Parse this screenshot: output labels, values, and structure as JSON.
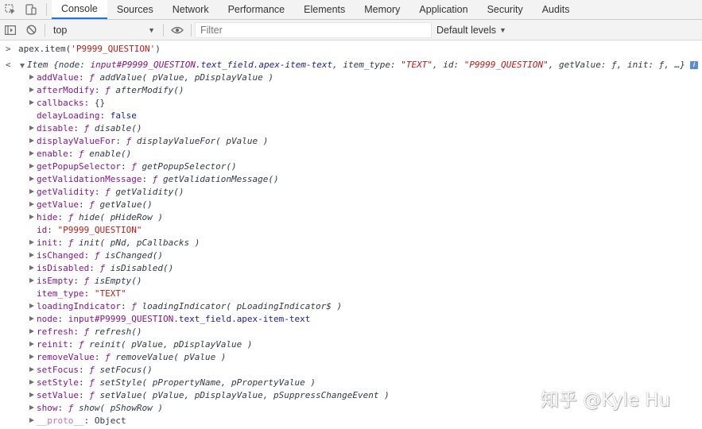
{
  "devtools": {
    "tabs": [
      {
        "label": "Console",
        "active": true
      },
      {
        "label": "Sources",
        "active": false
      },
      {
        "label": "Network",
        "active": false
      },
      {
        "label": "Performance",
        "active": false
      },
      {
        "label": "Elements",
        "active": false
      },
      {
        "label": "Memory",
        "active": false
      },
      {
        "label": "Application",
        "active": false
      },
      {
        "label": "Security",
        "active": false
      },
      {
        "label": "Audits",
        "active": false
      }
    ],
    "icons": [
      "inspect-element-icon",
      "device-toolbar-icon"
    ],
    "accent_color": "#1a73e8"
  },
  "console_toolbar": {
    "context": "top",
    "filter_placeholder": "Filter",
    "levels_label": "Default levels",
    "icons": [
      "sidebar-toggle-icon",
      "clear-console-icon",
      "live-expression-eye-icon"
    ]
  },
  "console": {
    "command": "apex.item('P9999_QUESTION')",
    "result_summary": {
      "prefix": "Item {node: ",
      "node_elem": "input",
      "node_id": "#P9999_QUESTION",
      "node_cls": ".text_field.apex-item-text",
      "mid1": ", item_type: ",
      "item_type": "\"TEXT\"",
      "mid2": ", id: ",
      "id": "\"P9999_QUESTION\"",
      "tail": ", getValue: ƒ, init: ƒ, …}",
      "info_badge": "i"
    },
    "properties": [
      {
        "key": "addValue",
        "sep": ": ",
        "f": "ƒ",
        "sig": "addValue( pValue, pDisplayValue )",
        "type": "fn",
        "expandable": true
      },
      {
        "key": "afterModify",
        "sep": ": ",
        "f": "ƒ",
        "sig": "afterModify()",
        "type": "fn",
        "expandable": true
      },
      {
        "key": "callbacks",
        "sep": ": ",
        "value": "{}",
        "type": "plain",
        "expandable": true
      },
      {
        "key": "delayLoading",
        "sep": ": ",
        "value": "false",
        "type": "kw",
        "expandable": false
      },
      {
        "key": "disable",
        "sep": ": ",
        "f": "ƒ",
        "sig": "disable()",
        "type": "fn",
        "expandable": true
      },
      {
        "key": "displayValueFor",
        "sep": ": ",
        "f": "ƒ",
        "sig": "displayValueFor( pValue )",
        "type": "fn",
        "expandable": true
      },
      {
        "key": "enable",
        "sep": ": ",
        "f": "ƒ",
        "sig": "enable()",
        "type": "fn",
        "expandable": true
      },
      {
        "key": "getPopupSelector",
        "sep": ": ",
        "f": "ƒ",
        "sig": "getPopupSelector()",
        "type": "fn",
        "expandable": true
      },
      {
        "key": "getValidationMessage",
        "sep": ": ",
        "f": "ƒ",
        "sig": "getValidationMessage()",
        "type": "fn",
        "expandable": true
      },
      {
        "key": "getValidity",
        "sep": ": ",
        "f": "ƒ",
        "sig": "getValidity()",
        "type": "fn",
        "expandable": true
      },
      {
        "key": "getValue",
        "sep": ": ",
        "f": "ƒ",
        "sig": "getValue()",
        "type": "fn",
        "expandable": true
      },
      {
        "key": "hide",
        "sep": ": ",
        "f": "ƒ",
        "sig": "hide( pHideRow )",
        "type": "fn",
        "expandable": true
      },
      {
        "key": "id",
        "sep": ": ",
        "value": "\"P9999_QUESTION\"",
        "type": "str",
        "expandable": false
      },
      {
        "key": "init",
        "sep": ": ",
        "f": "ƒ",
        "sig": "init( pNd, pCallbacks )",
        "type": "fn",
        "expandable": true
      },
      {
        "key": "isChanged",
        "sep": ": ",
        "f": "ƒ",
        "sig": "isChanged()",
        "type": "fn",
        "expandable": true
      },
      {
        "key": "isDisabled",
        "sep": ": ",
        "f": "ƒ",
        "sig": "isDisabled()",
        "type": "fn",
        "expandable": true
      },
      {
        "key": "isEmpty",
        "sep": ": ",
        "f": "ƒ",
        "sig": "isEmpty()",
        "type": "fn",
        "expandable": true
      },
      {
        "key": "item_type",
        "sep": ": ",
        "value": "\"TEXT\"",
        "type": "str",
        "expandable": false
      },
      {
        "key": "loadingIndicator",
        "sep": ": ",
        "f": "ƒ",
        "sig": "loadingIndicator( pLoadingIndicator$ )",
        "type": "fn",
        "expandable": true
      },
      {
        "key": "node",
        "sep": ": ",
        "elem": "input",
        "node_id": "#P9999_QUESTION",
        "node_cls": ".text_field.apex-item-text",
        "type": "node",
        "expandable": true
      },
      {
        "key": "refresh",
        "sep": ": ",
        "f": "ƒ",
        "sig": "refresh()",
        "type": "fn",
        "expandable": true
      },
      {
        "key": "reinit",
        "sep": ": ",
        "f": "ƒ",
        "sig": "reinit( pValue, pDisplayValue )",
        "type": "fn",
        "expandable": true
      },
      {
        "key": "removeValue",
        "sep": ": ",
        "f": "ƒ",
        "sig": "removeValue( pValue )",
        "type": "fn",
        "expandable": true
      },
      {
        "key": "setFocus",
        "sep": ": ",
        "f": "ƒ",
        "sig": "setFocus()",
        "type": "fn",
        "expandable": true
      },
      {
        "key": "setStyle",
        "sep": ": ",
        "f": "ƒ",
        "sig": "setStyle( pPropertyName, pPropertyValue )",
        "type": "fn",
        "expandable": true
      },
      {
        "key": "setValue",
        "sep": ": ",
        "f": "ƒ",
        "sig": "setValue( pValue, pDisplayValue, pSuppressChangeEvent )",
        "type": "fn",
        "expandable": true
      },
      {
        "key": "show",
        "sep": ": ",
        "f": "ƒ",
        "sig": "show( pShowRow )",
        "type": "fn",
        "expandable": true
      },
      {
        "key": "__proto__",
        "sep": ": ",
        "value": "Object",
        "type": "proto",
        "expandable": true
      }
    ],
    "colors": {
      "property_key": "#881391",
      "string": "#c41a16",
      "keyword": "#0d22aa",
      "text": "#303942"
    }
  },
  "watermark": "知乎 @Kyle Hu"
}
